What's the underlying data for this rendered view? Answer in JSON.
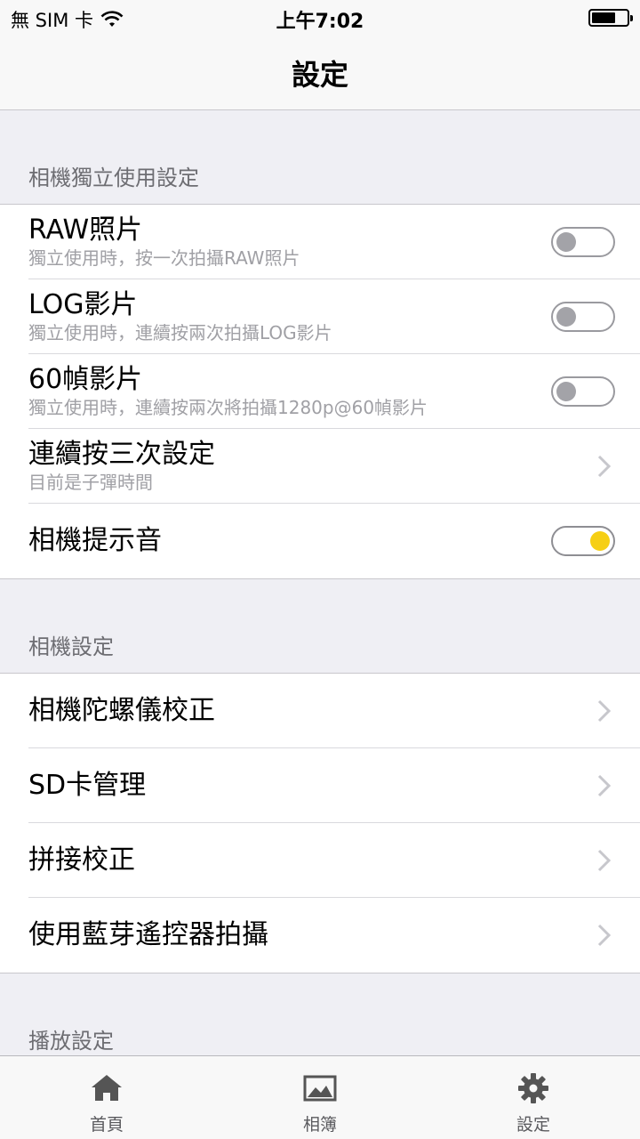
{
  "status_bar": {
    "carrier": "無 SIM 卡",
    "time": "上午7:02",
    "battery_icon": "battery-icon",
    "wifi_icon": "wifi-icon"
  },
  "nav": {
    "title": "設定"
  },
  "sections": {
    "standalone": {
      "header": "相機獨立使用設定",
      "raw": {
        "title": "RAW照片",
        "subtitle": "獨立使用時，按一次拍攝RAW照片",
        "enabled": false
      },
      "log": {
        "title": "LOG影片",
        "subtitle": "獨立使用時，連續按兩次拍攝LOG影片",
        "enabled": false
      },
      "fps60": {
        "title": "60幀影片",
        "subtitle": "獨立使用時，連續按兩次將拍攝1280p@60幀影片",
        "enabled": false
      },
      "triple": {
        "title": "連續按三次設定",
        "subtitle": "目前是子彈時間"
      },
      "sound": {
        "title": "相機提示音",
        "enabled": true
      }
    },
    "camera": {
      "header": "相機設定",
      "gyro": {
        "title": "相機陀螺儀校正"
      },
      "sd": {
        "title": "SD卡管理"
      },
      "stitch": {
        "title": "拼接校正"
      },
      "bluetooth": {
        "title": "使用藍芽遙控器拍攝"
      }
    },
    "playback": {
      "header": "播放設定"
    }
  },
  "tab_bar": {
    "home": {
      "label": "首頁",
      "icon": "home-icon"
    },
    "album": {
      "label": "相簿",
      "icon": "image-icon"
    },
    "settings": {
      "label": "設定",
      "icon": "gear-icon"
    }
  },
  "colors": {
    "toggle_on": "#f6cf14",
    "toggle_off_knob": "#a3a3a8",
    "background": "#efeff4"
  }
}
